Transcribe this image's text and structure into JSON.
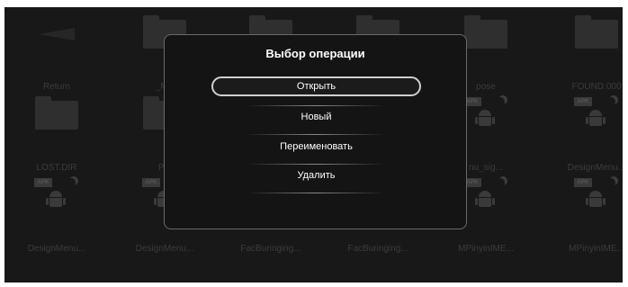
{
  "dialog": {
    "title": "Выбор операции",
    "options": [
      "Открыть",
      "Новый",
      "Переименовать",
      "Удалить"
    ],
    "selected": "Открыть"
  },
  "files": [
    {
      "label": "Return",
      "icon": "return-arrow-icon"
    },
    {
      "label": "_MS",
      "icon": "folder-icon"
    },
    {
      "label": "",
      "icon": "folder-icon"
    },
    {
      "label": "",
      "icon": "folder-icon"
    },
    {
      "label": "pose",
      "icon": "folder-icon"
    },
    {
      "label": "FOUND.000",
      "icon": "folder-icon"
    },
    {
      "label": "LOST.DIR",
      "icon": "folder-icon"
    },
    {
      "label": "Pic",
      "icon": "folder-icon"
    },
    {
      "label": "",
      "icon": "apk-icon"
    },
    {
      "label": "",
      "icon": "apk-icon"
    },
    {
      "label": "nu_sig...",
      "icon": "apk-icon"
    },
    {
      "label": "DesignMenu...",
      "icon": "apk-icon"
    },
    {
      "label": "DesignMenu...",
      "icon": "apk-icon"
    },
    {
      "label": "DesignMenu...",
      "icon": "apk-icon"
    },
    {
      "label": "FacBuringing...",
      "icon": "apk-icon"
    },
    {
      "label": "FacBuringing...",
      "icon": "apk-icon"
    },
    {
      "label": "MPinyinIME...",
      "icon": "apk-icon"
    },
    {
      "label": "MPinyinIME...",
      "icon": "apk-icon"
    }
  ],
  "colors": {
    "background": "#181818",
    "dialog_border": "#6a6a6a",
    "dialog_text": "#ffffff",
    "dim_label": "#3c3c3c"
  }
}
